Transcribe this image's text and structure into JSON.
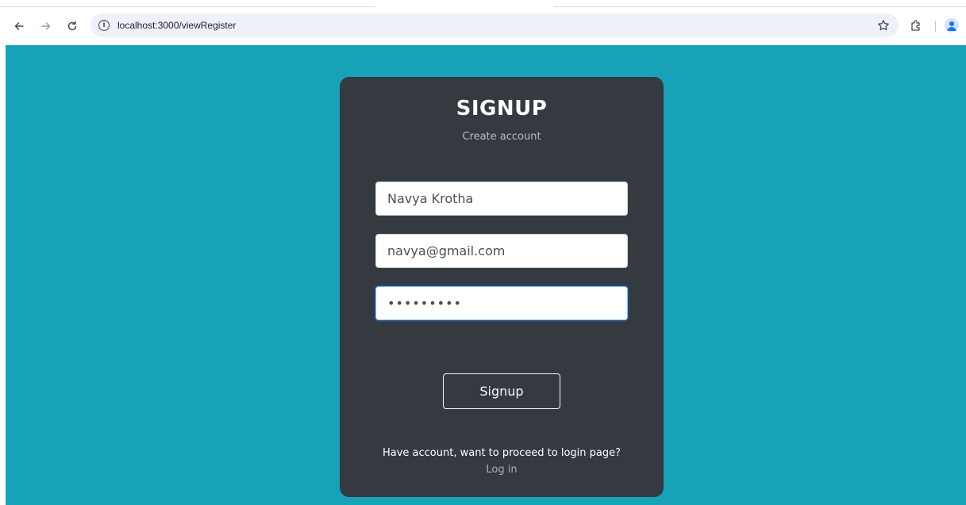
{
  "browser": {
    "url": "localhost:3000/viewRegister",
    "icons": {
      "back": "arrow-left-icon",
      "forward": "arrow-right-icon",
      "reload": "reload-icon",
      "site_info": "info-icon",
      "bookmark": "star-icon",
      "extensions": "puzzle-icon",
      "profile": "profile-icon"
    }
  },
  "colors": {
    "page_background": "#17a2b8",
    "card_background": "#343a40",
    "focus_border": "#80bdff"
  },
  "signup": {
    "title": "SIGNUP",
    "subtitle": "Create account",
    "name_value": "Navya Krotha",
    "email_value": "navya@gmail.com",
    "password_value": "•••••••••",
    "button_label": "Signup",
    "login_prompt": "Have account, want to proceed to login page?",
    "login_link": "Log in"
  }
}
